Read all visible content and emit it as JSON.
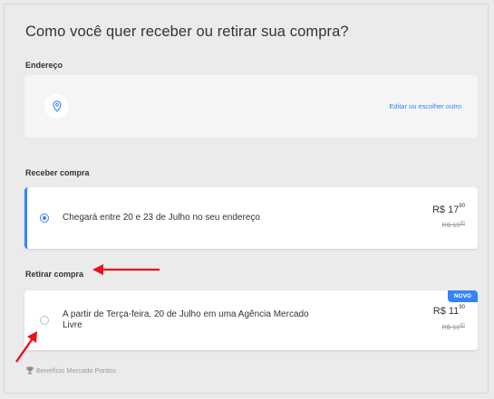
{
  "title": "Como você quer receber ou retirar sua compra?",
  "address": {
    "label": "Endereço",
    "edit_link": "Editar ou escolher outro",
    "icon": "location-pin-icon"
  },
  "deliver": {
    "label": "Receber compra",
    "option_text": "Chegará entre 20 e 23 de Julho no seu endereço",
    "price_int": "R$ 17",
    "price_cents": "90",
    "old_price_int": "R$ 19",
    "old_price_cents": "90",
    "selected": true
  },
  "pickup": {
    "label": "Retirar compra",
    "option_text_line1": "A partir de Terça-feira, 20 de Julho em uma Agência Mercado",
    "option_text_line2": "Livre",
    "badge": "NOVO",
    "price_int": "R$ 11",
    "price_cents": "90",
    "old_price_int": "R$ 12",
    "old_price_cents": "90",
    "selected": false
  },
  "footer": {
    "text": "Benefício Mercado Pontos",
    "icon": "trophy-icon"
  },
  "colors": {
    "accent": "#3483fa",
    "annotation_arrow": "#e8121b",
    "background": "#ebebeb"
  }
}
